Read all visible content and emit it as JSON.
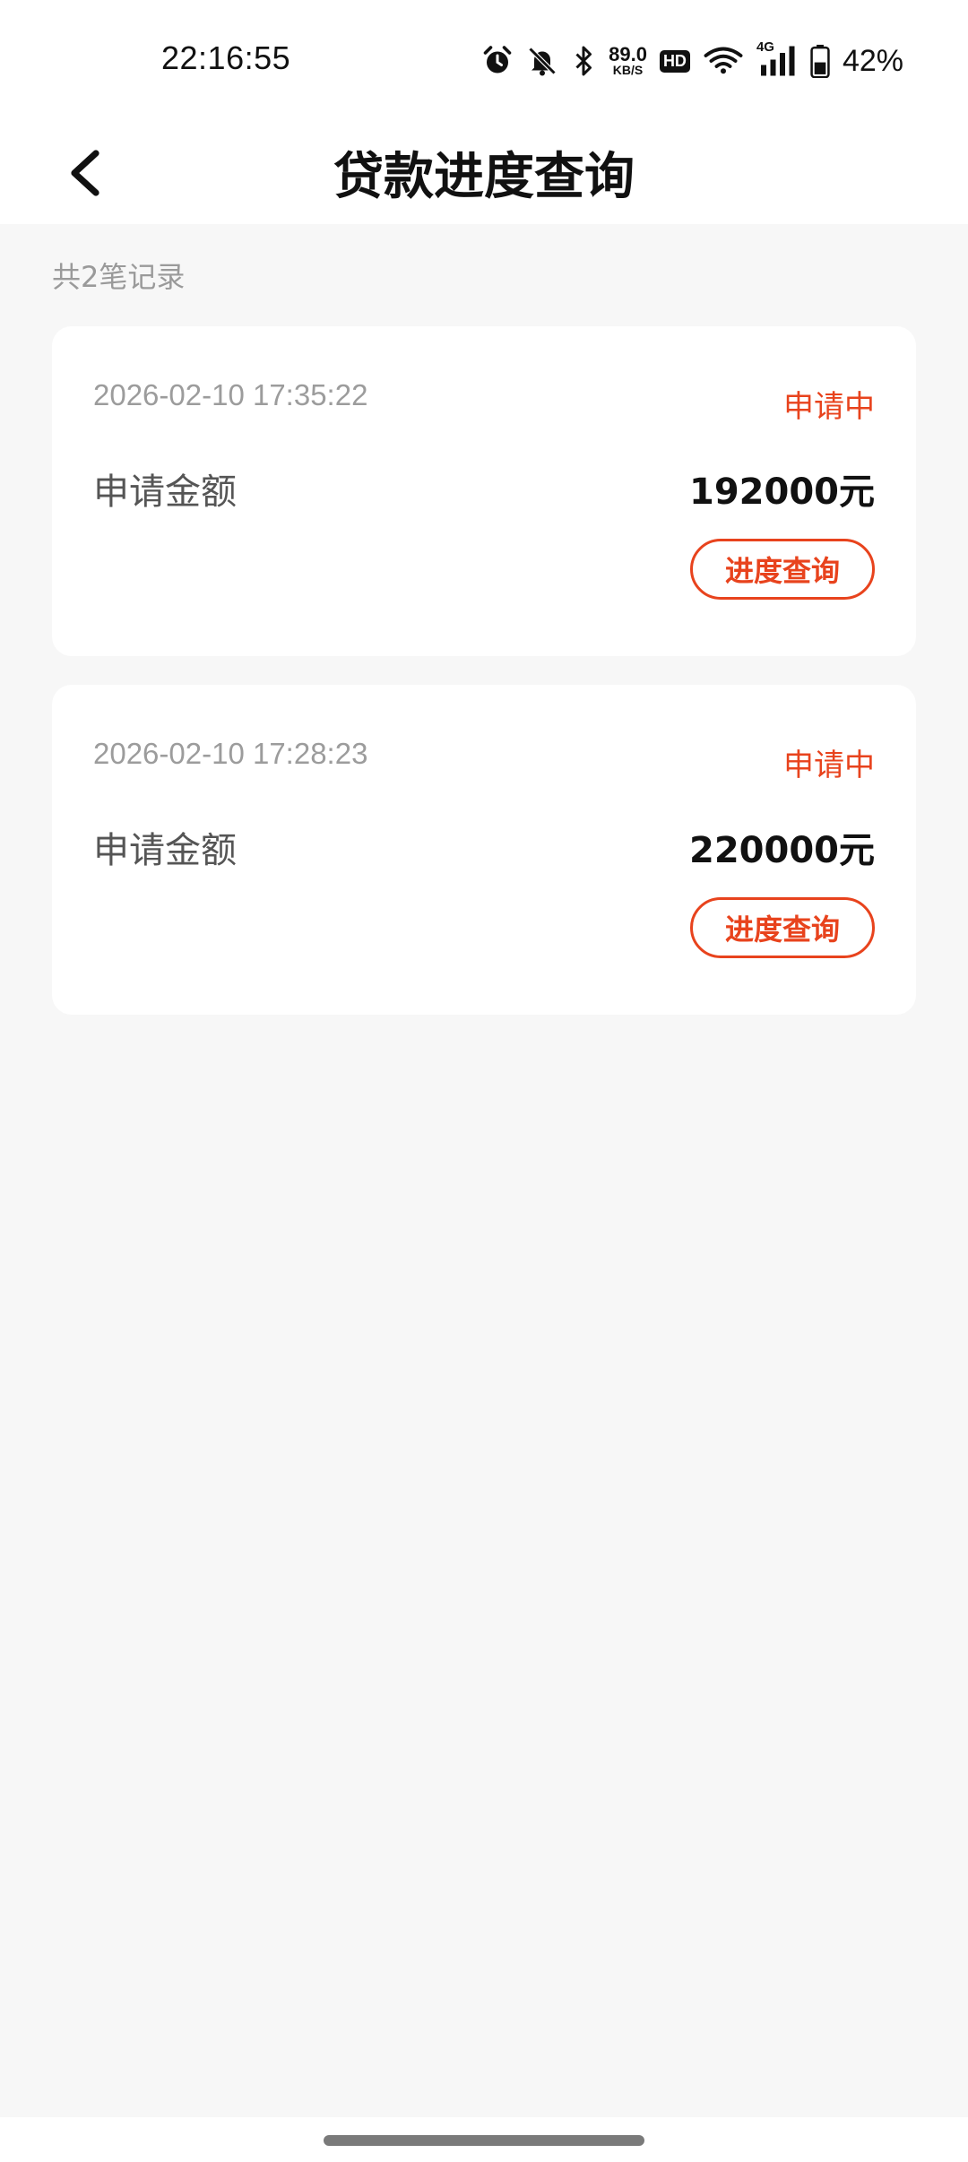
{
  "status_bar": {
    "time": "22:16:55",
    "net_speed_value": "89.0",
    "net_speed_unit": "KB/S",
    "hd_label": "HD",
    "network_label": "4G",
    "battery_percent": "42%",
    "icons": [
      "alarm-icon",
      "mute-bell-icon",
      "bluetooth-icon",
      "wifi-icon",
      "signal-icon",
      "battery-icon"
    ]
  },
  "header": {
    "title": "贷款进度查询"
  },
  "summary": {
    "record_count_text": "共2笔记录"
  },
  "records": [
    {
      "time": "2026-02-10 17:35:22",
      "status": "申请中",
      "amount_label": "申请金额",
      "amount": "192000元",
      "button_label": "进度查询"
    },
    {
      "time": "2026-02-10 17:28:23",
      "status": "申请中",
      "amount_label": "申请金额",
      "amount": "220000元",
      "button_label": "进度查询"
    }
  ],
  "colors": {
    "accent": "#e8431d",
    "background": "#f7f7f7",
    "card": "#ffffff"
  }
}
